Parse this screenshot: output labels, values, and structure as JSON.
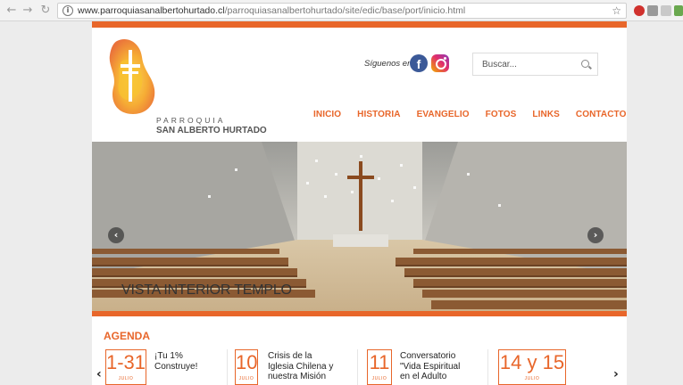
{
  "browser": {
    "url_host": "www.parroquiasanalbertohurtado.cl",
    "url_path": "/parroquiasanalbertohurtado/site/edic/base/port/inicio.html"
  },
  "logo": {
    "line1": "PARROQUIA",
    "line2": "SAN ALBERTO HURTADO"
  },
  "social": {
    "label": "Síguenos en:"
  },
  "search": {
    "placeholder": "Buscar..."
  },
  "menu": [
    "INICIO",
    "HISTORIA",
    "EVANGELIO",
    "FOTOS",
    "LINKS",
    "CONTACTO"
  ],
  "slider": {
    "caption": "VISTA INTERIOR TEMPLO"
  },
  "agenda": {
    "title": "AGENDA",
    "events": [
      {
        "date": "1-31",
        "month": "JULIO",
        "lines": [
          "¡Tu 1%",
          "Construye!"
        ]
      },
      {
        "date": "10",
        "month": "JULIO",
        "lines": [
          "Crisis de la",
          "Iglesia Chilena y",
          "nuestra Misión"
        ]
      },
      {
        "date": "11",
        "month": "JULIO",
        "lines": [
          "Conversatorio",
          "\"Vida Espiritual",
          "en el Adulto"
        ]
      },
      {
        "date": "14 y 15",
        "month": "JULIO",
        "lines": []
      }
    ]
  },
  "colors": {
    "accent": "#e8662a",
    "facebook": "#3b5998"
  }
}
